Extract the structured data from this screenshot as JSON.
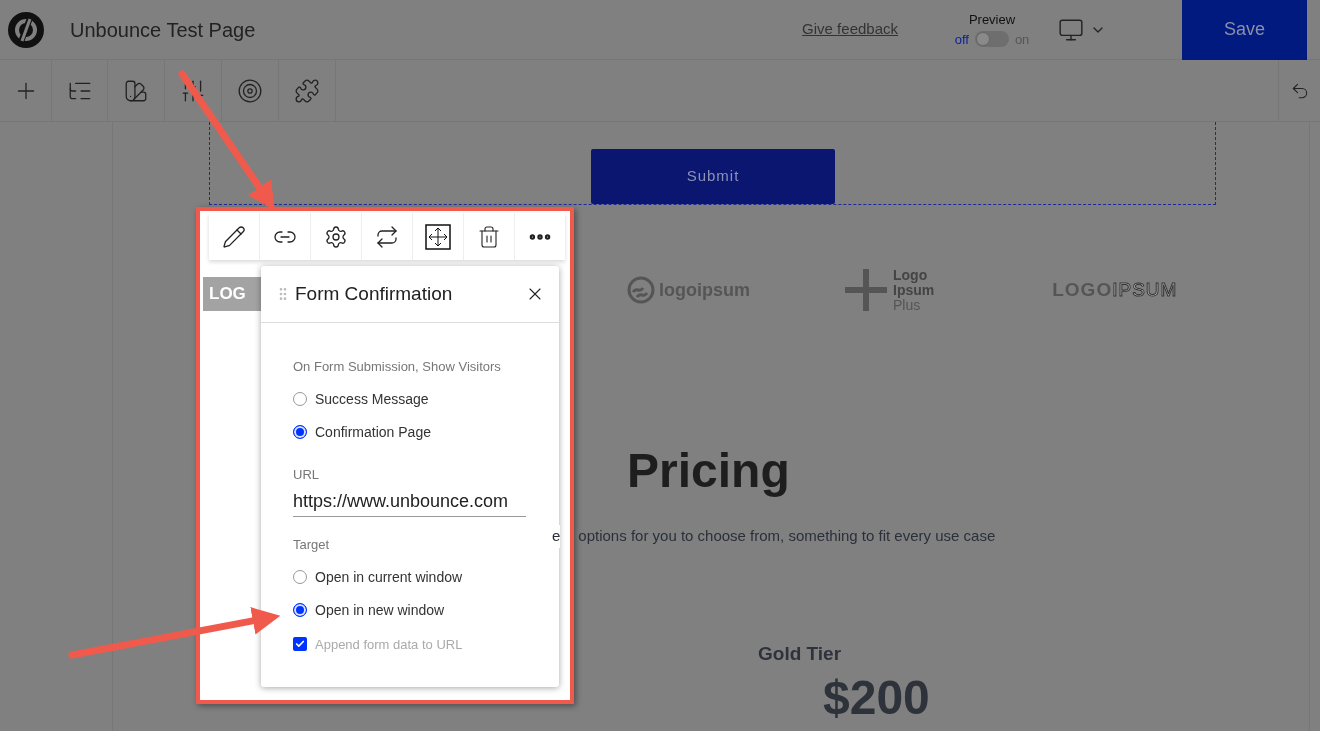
{
  "header": {
    "title": "Unbounce Test Page",
    "feedback_link": "Give feedback",
    "preview": {
      "label": "Preview",
      "off_label": "off",
      "on_label": "on",
      "on": false
    },
    "save_button": "Save"
  },
  "canvas": {
    "submit_button": "Submit",
    "logos": [
      {
        "kind": "wave",
        "text": "logoipsum"
      },
      {
        "kind": "stacked",
        "lines": [
          "Logo",
          "Ipsum",
          "Plus"
        ]
      },
      {
        "kind": "split",
        "bold": "LOGO",
        "outline": "IPSUM"
      }
    ],
    "heading": "Pricing",
    "subtitle_fragment": "e",
    "subtitle": "options for you to choose from, something to fit every use case",
    "tier": {
      "name": "Gold Tier",
      "price": "$200"
    }
  },
  "overlay": {
    "logo_text": "LOG"
  },
  "popup": {
    "title": "Form Confirmation",
    "show_label": "On Form Submission, Show Visitors",
    "show_options": [
      {
        "label": "Success Message",
        "selected": false
      },
      {
        "label": "Confirmation Page",
        "selected": true
      }
    ],
    "url_label": "URL",
    "url_value": "https://www.unbounce.com",
    "target_label": "Target",
    "target_options": [
      {
        "label": "Open in current window",
        "selected": false
      },
      {
        "label": "Open in new window",
        "selected": true
      }
    ],
    "append": {
      "label": "Append form data to URL",
      "checked": true
    }
  }
}
